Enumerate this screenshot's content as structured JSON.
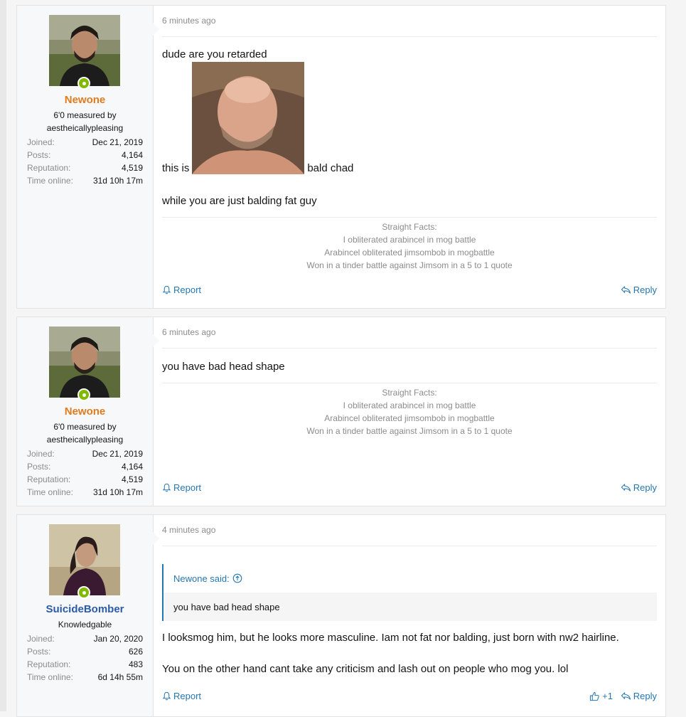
{
  "posts": [
    {
      "author": {
        "name": "Newone",
        "name_color": "#e07b1f",
        "title_line1": "6'0 measured by",
        "title_line2": "aestheicallypleasing"
      },
      "stats": [
        {
          "label": "Joined:",
          "value": "Dec 21, 2019"
        },
        {
          "label": "Posts:",
          "value": "4,164"
        },
        {
          "label": "Reputation:",
          "value": "4,519"
        },
        {
          "label": "Time online:",
          "value": "31d 10h 17m"
        }
      ],
      "time": "6 minutes ago",
      "body_line1": "dude are you retarded",
      "body_inline_before": "this is",
      "body_inline_after": "bald chad",
      "body_line3": "while you are just balding fat guy",
      "signature": [
        "Straight Facts:",
        "I obliterated arabincel in mog battle",
        "Arabincel obliterated jimsombob in mogbattle",
        "Won in a tinder battle against Jimsom in a 5 to 1 quote"
      ],
      "report": "Report",
      "reply": "Reply"
    },
    {
      "author": {
        "name": "Newone",
        "name_color": "#e07b1f",
        "title_line1": "6'0 measured by",
        "title_line2": "aestheicallypleasing"
      },
      "stats": [
        {
          "label": "Joined:",
          "value": "Dec 21, 2019"
        },
        {
          "label": "Posts:",
          "value": "4,164"
        },
        {
          "label": "Reputation:",
          "value": "4,519"
        },
        {
          "label": "Time online:",
          "value": "31d 10h 17m"
        }
      ],
      "time": "6 minutes ago",
      "body": "you have bad head shape",
      "signature": [
        "Straight Facts:",
        "I obliterated arabincel in mog battle",
        "Arabincel obliterated jimsombob in mogbattle",
        "Won in a tinder battle against Jimsom in a 5 to 1 quote"
      ],
      "report": "Report",
      "reply": "Reply"
    },
    {
      "author": {
        "name": "SuicideBomber",
        "name_color": "#2a5aa8",
        "title_line1": "Knowledgable"
      },
      "stats": [
        {
          "label": "Joined:",
          "value": "Jan 20, 2020"
        },
        {
          "label": "Posts:",
          "value": "626"
        },
        {
          "label": "Reputation:",
          "value": "483"
        },
        {
          "label": "Time online:",
          "value": "6d 14h 55m"
        }
      ],
      "time": "4 minutes ago",
      "quote": {
        "author": "Newone said:",
        "text": "you have bad head shape"
      },
      "body_line1": "I looksmog him, but he looks more masculine. Iam not fat nor balding, just born with nw2 hairline.",
      "body_line2": "You on the other hand cant take any criticism and lash out on people who mog you. lol",
      "report": "Report",
      "like_count": "+1",
      "reply": "Reply"
    }
  ]
}
